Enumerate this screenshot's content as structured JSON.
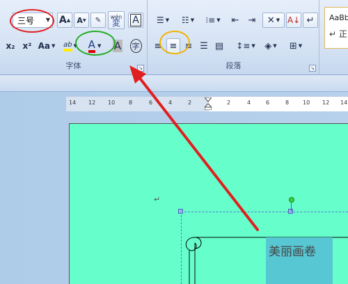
{
  "ribbon": {
    "font_group": {
      "label": "字体",
      "font_size": "三号",
      "grow_font": "A",
      "shrink_font": "A",
      "phonetic": "wén",
      "phonetic_char": "変",
      "char_border": "A",
      "subscript": "x₂",
      "superscript": "x²",
      "change_case": "Aa",
      "highlight": "ab",
      "font_color": "A",
      "char_shading": "A",
      "enclosed_char": "字"
    },
    "paragraph_group": {
      "label": "段落"
    },
    "styles_group": {
      "sample": "AaBb",
      "sample_sub": "↵ 正"
    }
  },
  "ruler": {
    "left_ticks": [
      "14",
      "12",
      "10",
      "8",
      "6",
      "4",
      "2"
    ],
    "right_ticks": [
      "2",
      "4",
      "6",
      "8",
      "10",
      "12",
      "14"
    ]
  },
  "document": {
    "paragraph_mark": "↵",
    "textbox_text": "美丽画卷"
  },
  "colors": {
    "page_background": "#66ffcc",
    "textbox_fill": "#58c7d4",
    "annotation_red": "#e02020",
    "annotation_green": "#22aa22",
    "annotation_orange": "#f2b400"
  }
}
